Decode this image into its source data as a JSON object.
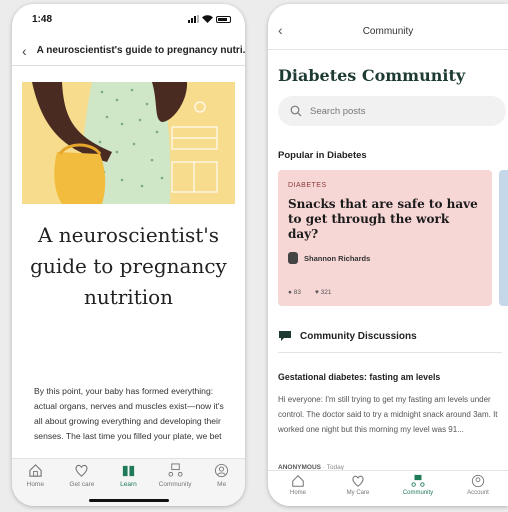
{
  "left": {
    "status_time": "1:48",
    "header_title": "A neuroscientist's guide to pregnancy nutri...",
    "article_title": "A neuroscientist's guide to pregnancy nutrition",
    "body": "By this point, your baby has formed everything: actual organs, nerves and muscles exist—now it's all about growing everything and developing their senses. The last time you filled your plate, we bet",
    "tabs": [
      {
        "label": "Home",
        "icon": "home-icon"
      },
      {
        "label": "Get care",
        "icon": "heart-icon"
      },
      {
        "label": "Learn",
        "icon": "book-icon"
      },
      {
        "label": "Community",
        "icon": "community-icon"
      },
      {
        "label": "Me",
        "icon": "user-icon"
      }
    ],
    "active_tab": "Learn"
  },
  "right": {
    "header_title": "Community",
    "page_title": "Diabetes Community",
    "search_placeholder": "Search posts",
    "popular_heading": "Popular in Diabetes",
    "card": {
      "tag": "DIABETES",
      "title": "Snacks that are safe to have to get through the work day?",
      "author": "Shannon Richards",
      "comments": "83",
      "likes": "321"
    },
    "discussions_heading": "Community Discussions",
    "post": {
      "title": "Gestational diabetes: fasting am levels",
      "body": "Hi everyone: I'm still trying to get my fasting am levels under control. The doctor said to try a midnight snack around 3am. It worked one night but this morning my level was 91...",
      "author": "ANONYMOUS",
      "time": "· Today"
    },
    "tabs": [
      {
        "label": "Home",
        "icon": "home-icon"
      },
      {
        "label": "My Care",
        "icon": "heart-icon"
      },
      {
        "label": "Community",
        "icon": "community-icon"
      },
      {
        "label": "Account",
        "icon": "user-icon"
      }
    ],
    "active_tab": "Community"
  },
  "colors": {
    "accent": "#1f7a57",
    "card_bg": "#f7d6d6",
    "hero_bg": "#f7dc8d"
  }
}
